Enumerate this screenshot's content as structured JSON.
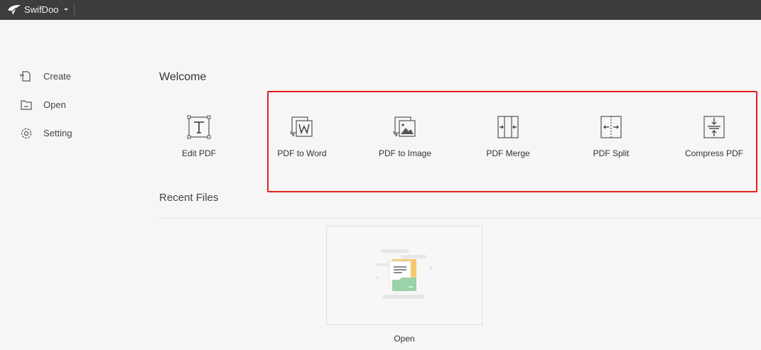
{
  "titlebar": {
    "app_name": "SwifDoo"
  },
  "sidebar": {
    "items": [
      {
        "label": "Create"
      },
      {
        "label": "Open"
      },
      {
        "label": "Setting"
      }
    ]
  },
  "main": {
    "welcome": "Welcome",
    "tools": [
      {
        "label": "Edit PDF"
      },
      {
        "label": "PDF to Word"
      },
      {
        "label": "PDF to Image"
      },
      {
        "label": "PDF Merge"
      },
      {
        "label": "PDF Split"
      },
      {
        "label": "Compress PDF"
      }
    ],
    "recent_title": "Recent Files",
    "open_label": "Open"
  },
  "colors": {
    "titlebar_bg": "#3c3d3f",
    "highlight_border": "#e02020",
    "page_bg": "#f6f6f6",
    "folder_green": "#9ad3a8",
    "folder_yellow": "#f5c96a"
  }
}
